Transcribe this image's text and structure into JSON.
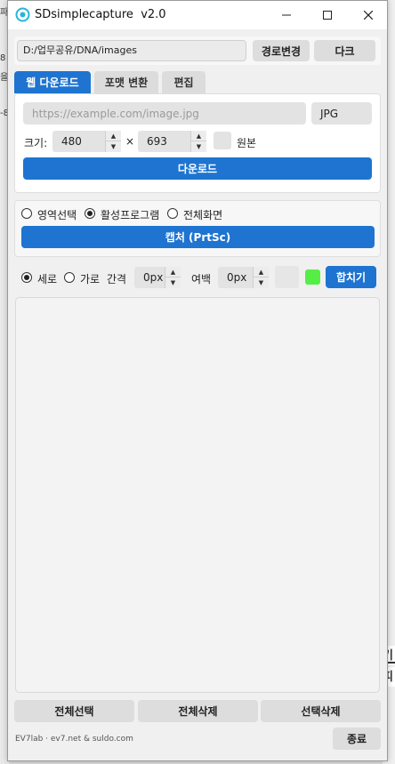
{
  "background": {
    "left_marks": [
      "파",
      "8",
      "을",
      "-8"
    ],
    "right_marks": [
      "기",
      "피"
    ]
  },
  "window": {
    "title": "SDsimplecapture  v2.0",
    "controls": {
      "minimize": "minimize",
      "maximize": "maximize",
      "close": "close"
    }
  },
  "path_bar": {
    "path": "D:/업무공유/DNA/images",
    "change_path_label": "경로변경",
    "theme_label": "다크"
  },
  "tabs": [
    {
      "label": "웹 다운로드",
      "active": true
    },
    {
      "label": "포맷 변환",
      "active": false
    },
    {
      "label": "편집",
      "active": false
    }
  ],
  "web_download": {
    "url_placeholder": "https://example.com/image.jpg",
    "format": "JPG",
    "size_label": "크기:",
    "width": "480",
    "times": "×",
    "height": "693",
    "original_label": "원본",
    "download_label": "다운로드"
  },
  "capture": {
    "modes": [
      {
        "label": "영역선택",
        "selected": false
      },
      {
        "label": "활성프로그램",
        "selected": true
      },
      {
        "label": "전체화면",
        "selected": false
      }
    ],
    "capture_label": "캡처 (PrtSc)"
  },
  "merge": {
    "orientation": [
      {
        "label": "세로",
        "selected": true
      },
      {
        "label": "가로",
        "selected": false
      }
    ],
    "gap_label": "간격",
    "gap_value": "0px",
    "margin_label": "여백",
    "margin_value": "0px",
    "color_a": "#e6e6e6",
    "color_b": "#55ee44",
    "merge_label": "합치기"
  },
  "actions": {
    "select_all": "전체선택",
    "delete_all": "전체삭제",
    "delete_selected": "선택삭제"
  },
  "footer": {
    "credit": "EV7lab · ev7.net & suldo.com",
    "exit_label": "종료"
  },
  "colors": {
    "accent": "#1e74d0",
    "panel": "#f0f0f0"
  }
}
